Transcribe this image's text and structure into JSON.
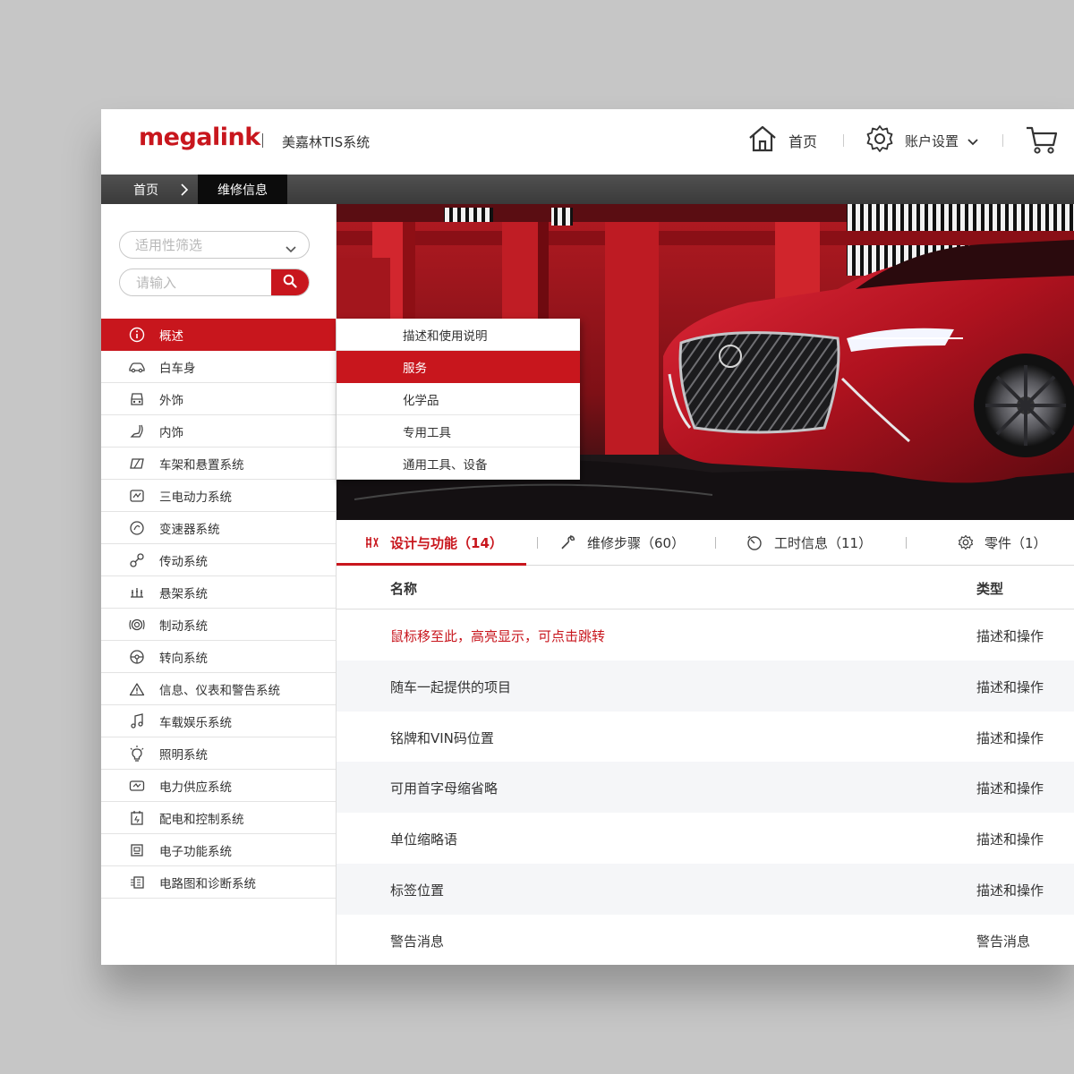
{
  "header": {
    "logo_text": "megalink",
    "system_name": "美嘉林TIS系统",
    "home_label": "首页",
    "account_label": "账户设置"
  },
  "breadcrumb": {
    "home": "首页",
    "current": "维修信息"
  },
  "sidebar": {
    "filter_label": "适用性筛选",
    "search_placeholder": "请输入",
    "items": [
      {
        "label": "概述",
        "icon": "info-icon"
      },
      {
        "label": "白车身",
        "icon": "car-body-icon"
      },
      {
        "label": "外饰",
        "icon": "exterior-icon"
      },
      {
        "label": "内饰",
        "icon": "seat-icon"
      },
      {
        "label": "车架和悬置系统",
        "icon": "frame-icon"
      },
      {
        "label": "三电动力系统",
        "icon": "power-icon"
      },
      {
        "label": "变速器系统",
        "icon": "transmission-icon"
      },
      {
        "label": "传动系统",
        "icon": "drive-icon"
      },
      {
        "label": "悬架系统",
        "icon": "suspension-icon"
      },
      {
        "label": "制动系统",
        "icon": "brake-icon"
      },
      {
        "label": "转向系统",
        "icon": "steering-icon"
      },
      {
        "label": "信息、仪表和警告系统",
        "icon": "warning-icon"
      },
      {
        "label": "车载娱乐系统",
        "icon": "music-icon"
      },
      {
        "label": "照明系统",
        "icon": "bulb-icon"
      },
      {
        "label": "电力供应系统",
        "icon": "battery-icon"
      },
      {
        "label": "配电和控制系统",
        "icon": "distribution-icon"
      },
      {
        "label": "电子功能系统",
        "icon": "electronic-icon"
      },
      {
        "label": "电路图和诊断系统",
        "icon": "circuit-icon"
      }
    ]
  },
  "flyout": {
    "items": [
      {
        "label": "描述和使用说明"
      },
      {
        "label": "服务"
      },
      {
        "label": "化学品"
      },
      {
        "label": "专用工具"
      },
      {
        "label": "通用工具、设备"
      }
    ]
  },
  "tabs": [
    {
      "label": "设计与功能（14）",
      "icon": "design-icon"
    },
    {
      "label": "维修步骤（60）",
      "icon": "wrench-icon"
    },
    {
      "label": "工时信息（11）",
      "icon": "timer-icon"
    },
    {
      "label": "零件（1）",
      "icon": "gear-icon"
    }
  ],
  "table": {
    "col_name": "名称",
    "col_type": "类型",
    "rows": [
      {
        "name": "鼠标移至此，高亮显示，可点击跳转",
        "type": "描述和操作"
      },
      {
        "name": "随车一起提供的项目",
        "type": "描述和操作"
      },
      {
        "name": "铭牌和VIN码位置",
        "type": "描述和操作"
      },
      {
        "name": "可用首字母缩省略",
        "type": "描述和操作"
      },
      {
        "name": "单位缩略语",
        "type": "描述和操作"
      },
      {
        "name": "标签位置",
        "type": "描述和操作"
      },
      {
        "name": "警告消息",
        "type": "警告消息"
      }
    ]
  },
  "colors": {
    "accent": "#c8161d",
    "breadcrumb_bg": "#3a3a3a",
    "row_alt": "#f5f6f8"
  }
}
